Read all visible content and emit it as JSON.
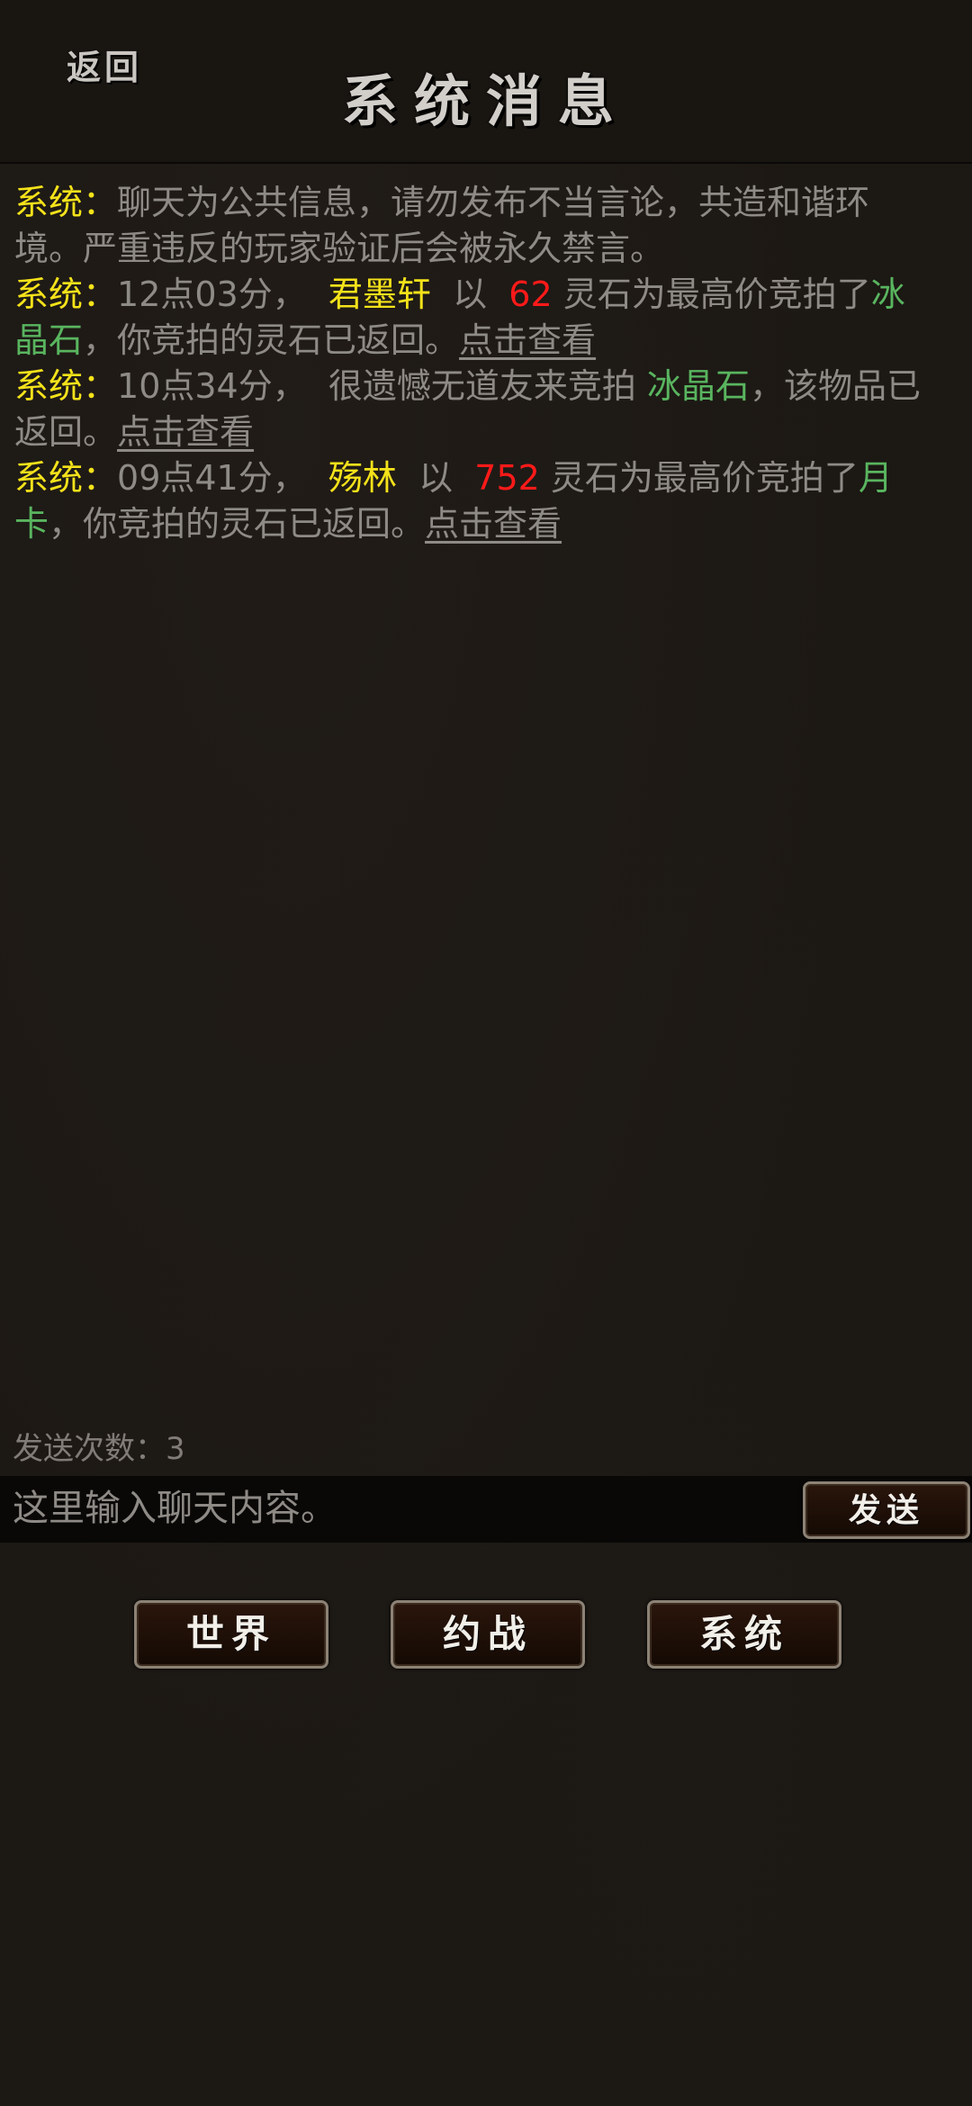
{
  "header": {
    "back_label": "返回",
    "title": "系统消息"
  },
  "messages": [
    {
      "prefix": "系统：",
      "text": "聊天为公共信息，请勿发布不当言论，共造和谐环境。严重违反的玩家验证后会被永久禁言。"
    },
    {
      "prefix": "系统：",
      "time": "12点03分，",
      "player": "君墨轩",
      "word_yi": "以",
      "amount": "62",
      "mid": "灵石为最高价竞拍了",
      "item": "冰晶石",
      "tail": "，你竞拍的灵石已返回。",
      "link": "点击查看"
    },
    {
      "prefix": "系统：",
      "time": "10点34分，",
      "mid": "很遗憾无道友来竞拍",
      "item": "冰晶石",
      "tail": "，该物品已返回。",
      "link": "点击查看"
    },
    {
      "prefix": "系统：",
      "time": "09点41分，",
      "player": "殇林",
      "word_yi": "以",
      "amount": "752",
      "mid": "灵石为最高价竞拍了",
      "item": "月卡",
      "tail": "，你竞拍的灵石已返回。",
      "link": "点击查看"
    }
  ],
  "send_count_label": "发送次数：3",
  "chat_input": {
    "placeholder": "这里输入聊天内容。",
    "value": ""
  },
  "send_label": "发送",
  "tabs": [
    {
      "label": "世界"
    },
    {
      "label": "约战"
    },
    {
      "label": "系统"
    }
  ],
  "colors": {
    "system_prefix": "#f4e21a",
    "player_name": "#f4e21a",
    "amount": "#ff1a1a",
    "item": "#59b55f",
    "body_text": "#8e8a86"
  }
}
